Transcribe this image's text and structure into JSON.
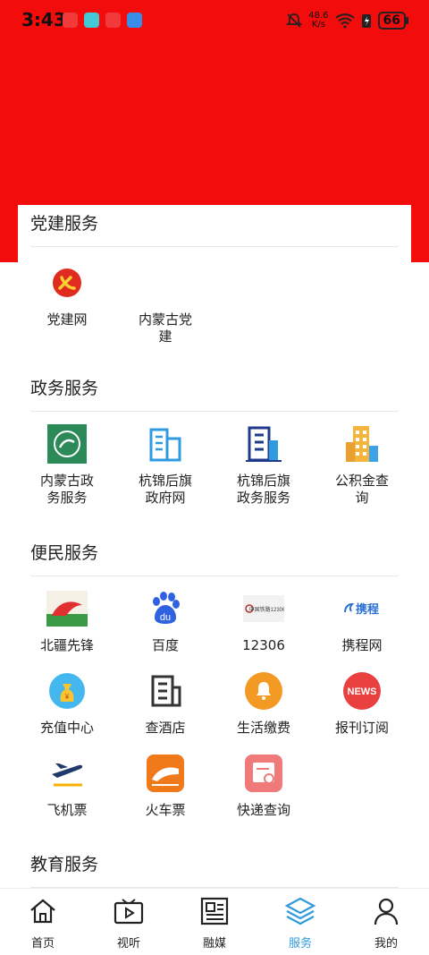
{
  "status_bar": {
    "time": "3:43",
    "speed_value": "48.6",
    "speed_unit": "K/s",
    "battery": "66"
  },
  "sections": [
    {
      "title": "党建服务",
      "items": [
        {
          "label": "党建网",
          "icon": "party-emblem-icon"
        },
        {
          "label": "内蒙古党建",
          "icon": "blank"
        }
      ]
    },
    {
      "title": "政务服务",
      "items": [
        {
          "label": "内蒙古政务服务",
          "icon": "gov-logo-icon"
        },
        {
          "label": "杭锦后旗政府网",
          "icon": "building-icon"
        },
        {
          "label": "杭锦后旗政务服务",
          "icon": "office-building-icon"
        },
        {
          "label": "公积金查询",
          "icon": "city-building-icon"
        }
      ]
    },
    {
      "title": "便民服务",
      "items": [
        {
          "label": "北疆先锋",
          "icon": "beijiang-logo-icon"
        },
        {
          "label": "百度",
          "icon": "baidu-icon"
        },
        {
          "label": "12306",
          "icon": "railway-logo-icon"
        },
        {
          "label": "携程网",
          "icon": "ctrip-logo-icon"
        },
        {
          "label": "充值中心",
          "icon": "money-bag-icon"
        },
        {
          "label": "查酒店",
          "icon": "hotel-icon"
        },
        {
          "label": "生活缴费",
          "icon": "bell-icon"
        },
        {
          "label": "报刊订阅",
          "icon": "news-icon"
        },
        {
          "label": "飞机票",
          "icon": "plane-icon"
        },
        {
          "label": "火车票",
          "icon": "train-icon"
        },
        {
          "label": "快递查询",
          "icon": "parcel-search-icon"
        }
      ]
    },
    {
      "title": "教育服务",
      "items": []
    }
  ],
  "logo_texts": {
    "railway": "中国铁路12306",
    "ctrip": "携程",
    "news": "NEWS",
    "baidu": "du"
  },
  "bottom_nav": [
    {
      "label": "首页",
      "icon": "home-icon",
      "active": false
    },
    {
      "label": "视听",
      "icon": "video-icon",
      "active": false
    },
    {
      "label": "融媒",
      "icon": "newspaper-icon",
      "active": false
    },
    {
      "label": "服务",
      "icon": "layers-icon",
      "active": true
    },
    {
      "label": "我的",
      "icon": "user-icon",
      "active": false
    }
  ],
  "colors": {
    "header_red": "#f20c0c",
    "accent_blue": "#2f9ae0"
  }
}
